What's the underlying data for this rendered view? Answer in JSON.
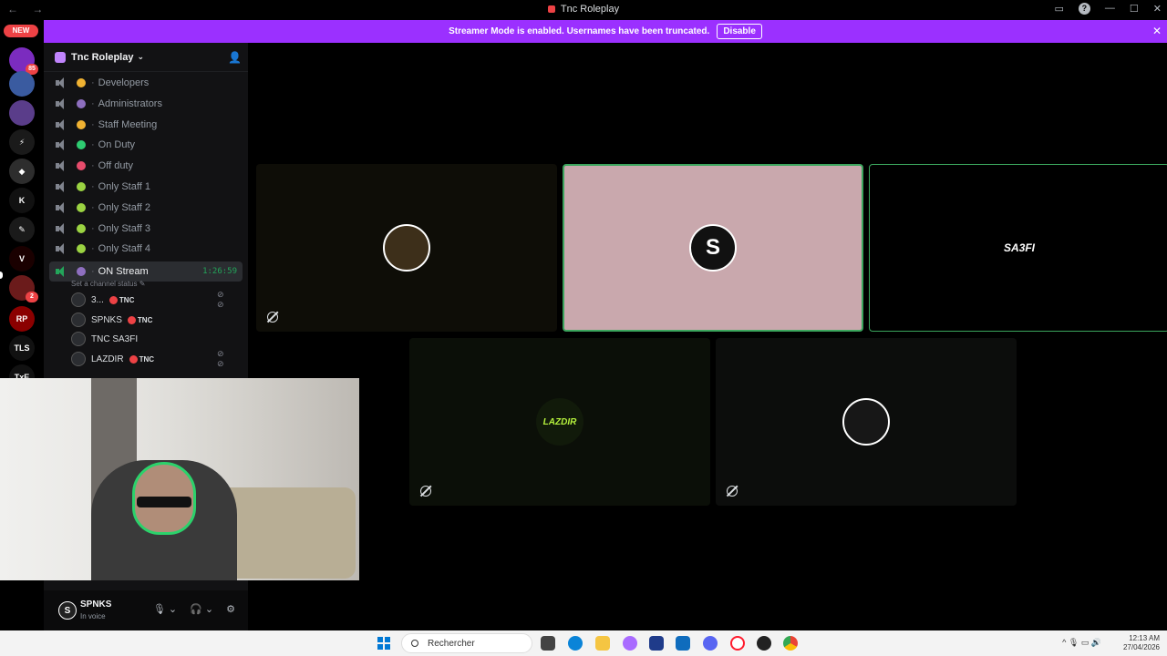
{
  "window": {
    "title": "Tnc Roleplay",
    "nav_glyphs": "← →"
  },
  "banner": {
    "message": "Streamer Mode is enabled. Usernames have been truncated.",
    "disable_label": "Disable",
    "close_glyph": "✕"
  },
  "rail": {
    "new_badge": "NEW",
    "servers": [
      {
        "label": "",
        "color": "#7b2cbf",
        "badge": "85"
      },
      {
        "label": "",
        "color": "#3a5ba0",
        "badge": ""
      },
      {
        "label": "",
        "color": "#5a3d8a",
        "badge": ""
      },
      {
        "label": "⚡",
        "color": "#1a1a1a",
        "badge": ""
      },
      {
        "label": "◆",
        "color": "#2d2d2d",
        "badge": ""
      },
      {
        "label": "K",
        "color": "#111111",
        "badge": ""
      },
      {
        "label": "✎",
        "color": "#1a1a1a",
        "badge": ""
      },
      {
        "label": "V",
        "color": "#1a0000",
        "badge": ""
      },
      {
        "label": "",
        "color": "#6b1b1b",
        "badge": "2"
      },
      {
        "label": "RP",
        "color": "#8b0000",
        "badge": ""
      },
      {
        "label": "TLS",
        "color": "#111111",
        "badge": ""
      },
      {
        "label": "TxE",
        "color": "#111111",
        "badge": ""
      }
    ]
  },
  "sidebar": {
    "guild_name": "Tnc Roleplay",
    "channels": [
      {
        "name": "Developers",
        "emoji_color": "#f0b232"
      },
      {
        "name": "Administrators",
        "emoji_color": "#8e6fbf"
      },
      {
        "name": "Staff Meeting",
        "emoji_color": "#f0b232"
      },
      {
        "name": "On Duty",
        "emoji_color": "#2ecc71"
      },
      {
        "name": "Off duty",
        "emoji_color": "#e74c6c"
      },
      {
        "name": "Only Staff 1",
        "emoji_color": "#9bd342"
      },
      {
        "name": "Only Staff 2",
        "emoji_color": "#9bd342"
      },
      {
        "name": "Only Staff 3",
        "emoji_color": "#9bd342"
      },
      {
        "name": "Only Staff 4",
        "emoji_color": "#9bd342"
      }
    ],
    "active_channel": {
      "name": "ON Stream",
      "timer": "1:26:59",
      "status_placeholder": "Set a channel status ✎"
    },
    "voice_users": [
      {
        "name": "3...",
        "tag": "TNC",
        "muted": true
      },
      {
        "name": "SPNKS",
        "tag": "TNC",
        "muted": false
      },
      {
        "name": "TNC SA3FI",
        "tag": "",
        "muted": false
      },
      {
        "name": "LAZDIR",
        "tag": "TNC",
        "muted": true
      }
    ],
    "separator": "·"
  },
  "user_panel": {
    "username": "SPNKS",
    "status": "In voice",
    "avatar_letter": "S",
    "controls": [
      "🎙 ⌄",
      "🎧 ⌄",
      "⚙"
    ]
  },
  "streams": [
    {
      "label": "",
      "bg": "#0e0d07",
      "avatar_color": "#3d2f1a",
      "selected": false,
      "speaking": false
    },
    {
      "label": "S",
      "bg": "#c9a8ad",
      "avatar_color": "#111111",
      "selected": true,
      "speaking": false
    },
    {
      "label": "SA3FI",
      "bg": "#000000",
      "avatar_color": "#000000",
      "selected": false,
      "speaking": true
    },
    {
      "label": "LAZDIR",
      "bg": "#0b0f08",
      "avatar_color": "#111a0a",
      "selected": false,
      "speaking": false
    },
    {
      "label": "",
      "bg": "#0c0d0c",
      "avatar_color": "#171717",
      "selected": false,
      "speaking": false
    }
  ],
  "taskbar": {
    "search_placeholder": "Rechercher",
    "time": "12:13 AM",
    "date": "27/04/2026",
    "tray_glyphs": "^  🎙  ▭  🔊"
  }
}
